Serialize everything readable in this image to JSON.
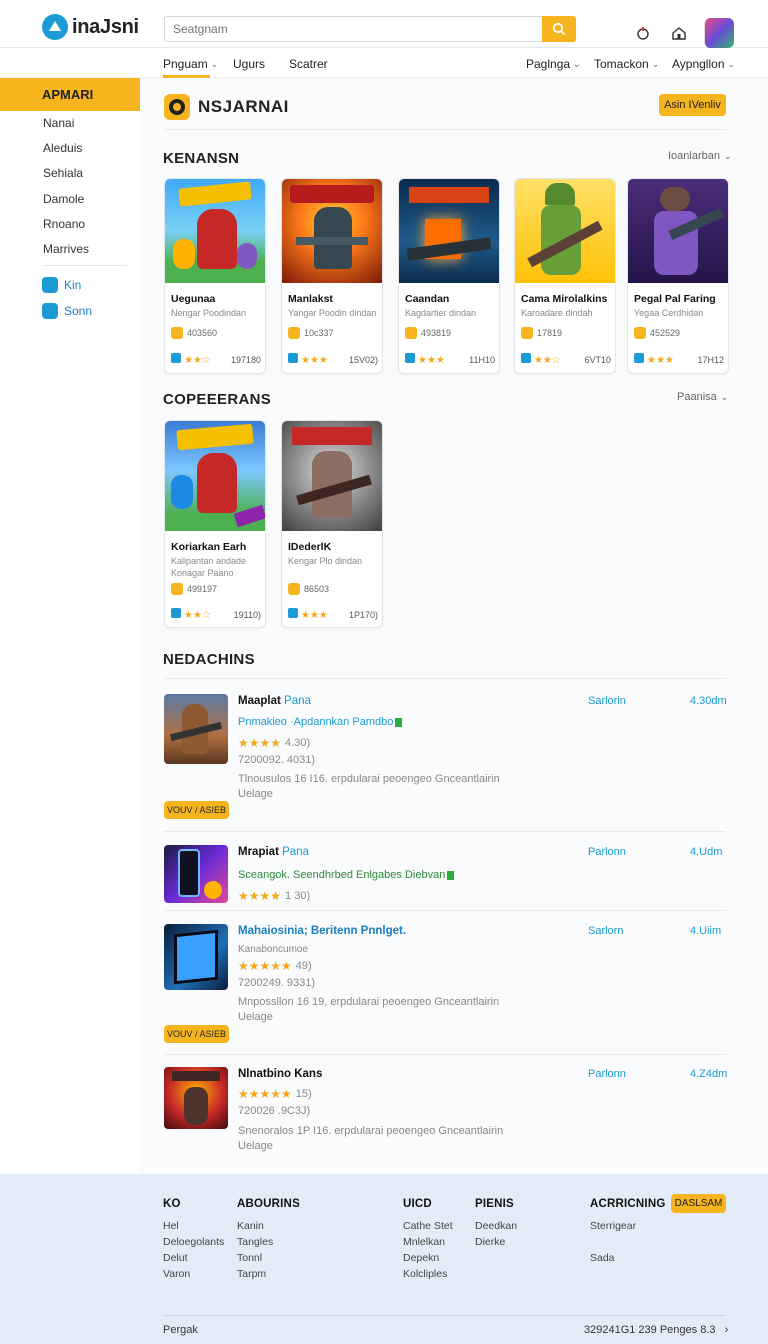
{
  "brand": {
    "name": "inaJsni",
    "accent": "#f6b51e",
    "blue": "#1c9ad6"
  },
  "search": {
    "placeholder": "Seatgnam"
  },
  "nav": {
    "left": [
      "Pnguam",
      "Ugurs",
      "Scatrer"
    ],
    "right": [
      "Paglnga",
      "Tomackon",
      "Aypngllon"
    ]
  },
  "sidebar": {
    "header": "APMARI",
    "items": [
      "Nanai",
      "Aleduis",
      "Sehiala",
      "Damole",
      "Rnoano",
      "Marrives"
    ],
    "links": [
      "Kin",
      "Sonn"
    ]
  },
  "main": {
    "title": "NSJARNAI",
    "cta": "Asin IVenliv"
  },
  "section1": {
    "title": "KENANSN",
    "sort": "Ioanlarban",
    "cards": [
      {
        "name": "Uegunaa",
        "sub": "Nengar Poodindan",
        "downloads": "403560",
        "count": "197180"
      },
      {
        "name": "Manlakst",
        "sub": "Yangar Poodin dindan",
        "downloads": "10c337",
        "count": "15V02)"
      },
      {
        "name": "Caandan",
        "sub": "Kagdartier dindan",
        "downloads": "493819",
        "count": "11H10"
      },
      {
        "name": "Cama Mirolalkins",
        "sub": "Karoadare dindah",
        "downloads": "17819",
        "count": "6VT10"
      },
      {
        "name": "Pegal Pal Faring",
        "sub": "Yegaa Cerdhidan",
        "downloads": "452529",
        "count": "17H12"
      }
    ]
  },
  "section2": {
    "title": "COPEEERANS",
    "sort": "Paanisa",
    "cards": [
      {
        "name": "Koriarkan Earh",
        "sub": "Kalipantan andade",
        "sub2": "Konagar Paano",
        "downloads": "499197",
        "count": "19110)"
      },
      {
        "name": "IDederlK",
        "sub": "Kengar Plo dindan",
        "downloads": "86503",
        "count": "1P170)"
      }
    ]
  },
  "section3": {
    "title": "NEDACHINS",
    "rows": [
      {
        "title": "Maaplat",
        "title2": "Pana",
        "sub": "Pnmakieo ·Apdannkan Pamdbo",
        "rating": "4.30)",
        "meta": "7200092. 4031)",
        "desc1": "Tlnousulos 16 I16. erpdularai peoengeo Gnceantlairin",
        "desc2": "Uelage",
        "status": "Sarlorin",
        "size": "4.30dm",
        "badge": "VOUV / ASIEB"
      },
      {
        "title": "Mrapiat",
        "title2": "Pana",
        "sub": "Sceangok. Seendhrbed Enlgabes Diebvan",
        "rating": "1 30)",
        "status": "Parlonn",
        "size": "4.Udm"
      },
      {
        "title": "Mahaiosinia; Beritenn Pnnlget.",
        "sub": "Kanaboncumoe",
        "rating": "49)",
        "meta": "7200249. 9331)",
        "desc1": "Mnpossllon 16 19, erpdularai peoengeo Gnceantlairin",
        "desc2": "Uelage",
        "status": "Sarlorn",
        "size": "4.Uiim",
        "badge": "VOUV / ASIEB"
      },
      {
        "title": "Nlnatbino",
        "title2": "Kans",
        "rating": "15)",
        "meta": "720026 .9C3J)",
        "desc1": "Snenoralos 1P I16. erpdularai peoengeo Gnceantlairin",
        "desc2": "Uelage",
        "status": "Parlonn",
        "size": "4.Z4dm"
      }
    ]
  },
  "footer": {
    "cols": [
      {
        "title": "KO",
        "items": [
          "Hel",
          "Deloegolants",
          "Delut",
          "Varon"
        ]
      },
      {
        "title": "ABOURINS",
        "items": [
          "Kanin",
          "Tangles",
          "Tonnl",
          "Tarpm"
        ]
      },
      {
        "title": "UICD",
        "items": [
          "Cathe Stet",
          "Mnlelkan",
          "Depekn",
          "Kolcliples"
        ]
      },
      {
        "title": "PIENIS",
        "items": [
          "Deedkan",
          "Dierke"
        ]
      },
      {
        "title": "ACRRICNING",
        "items": [
          "Sterrigear",
          "",
          "Sada"
        ]
      }
    ],
    "button": "DASLSAM",
    "left": "Pergak",
    "right": "329241G1 239 Penges  8.3",
    "arrow": "›"
  }
}
